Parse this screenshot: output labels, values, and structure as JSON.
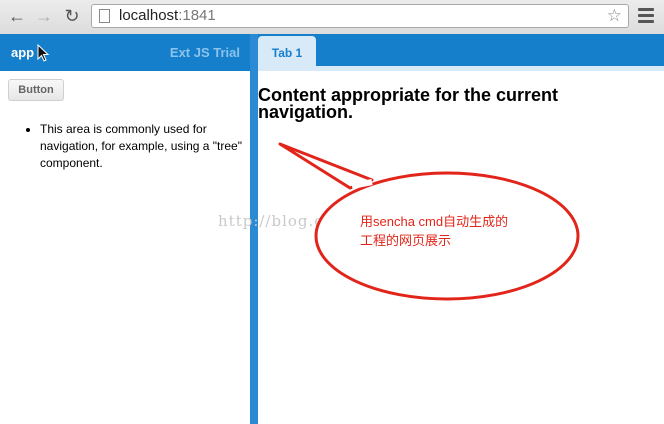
{
  "browser": {
    "url_host": "localhost",
    "url_port": ":1841",
    "back_icon": "arrow-left-icon",
    "forward_icon": "arrow-right-icon",
    "reload_icon": "reload-icon"
  },
  "app": {
    "title": "app",
    "trial_label": "Ext JS Trial",
    "button_label": "Button",
    "nav_text": "This area is commonly used for navigation, for example, using a \"tree\" component."
  },
  "tabs": [
    {
      "label": "Tab 1",
      "content": "Content appropriate for the current navigation."
    }
  ],
  "watermark": "http://blog.cs",
  "annotation": {
    "line1": "用sencha cmd自动生成的",
    "line2": "工程的网页展示"
  },
  "colors": {
    "header_blue": "#157fcc",
    "tab_bg": "#d8e9f7",
    "annotation_red": "#e2251a"
  }
}
